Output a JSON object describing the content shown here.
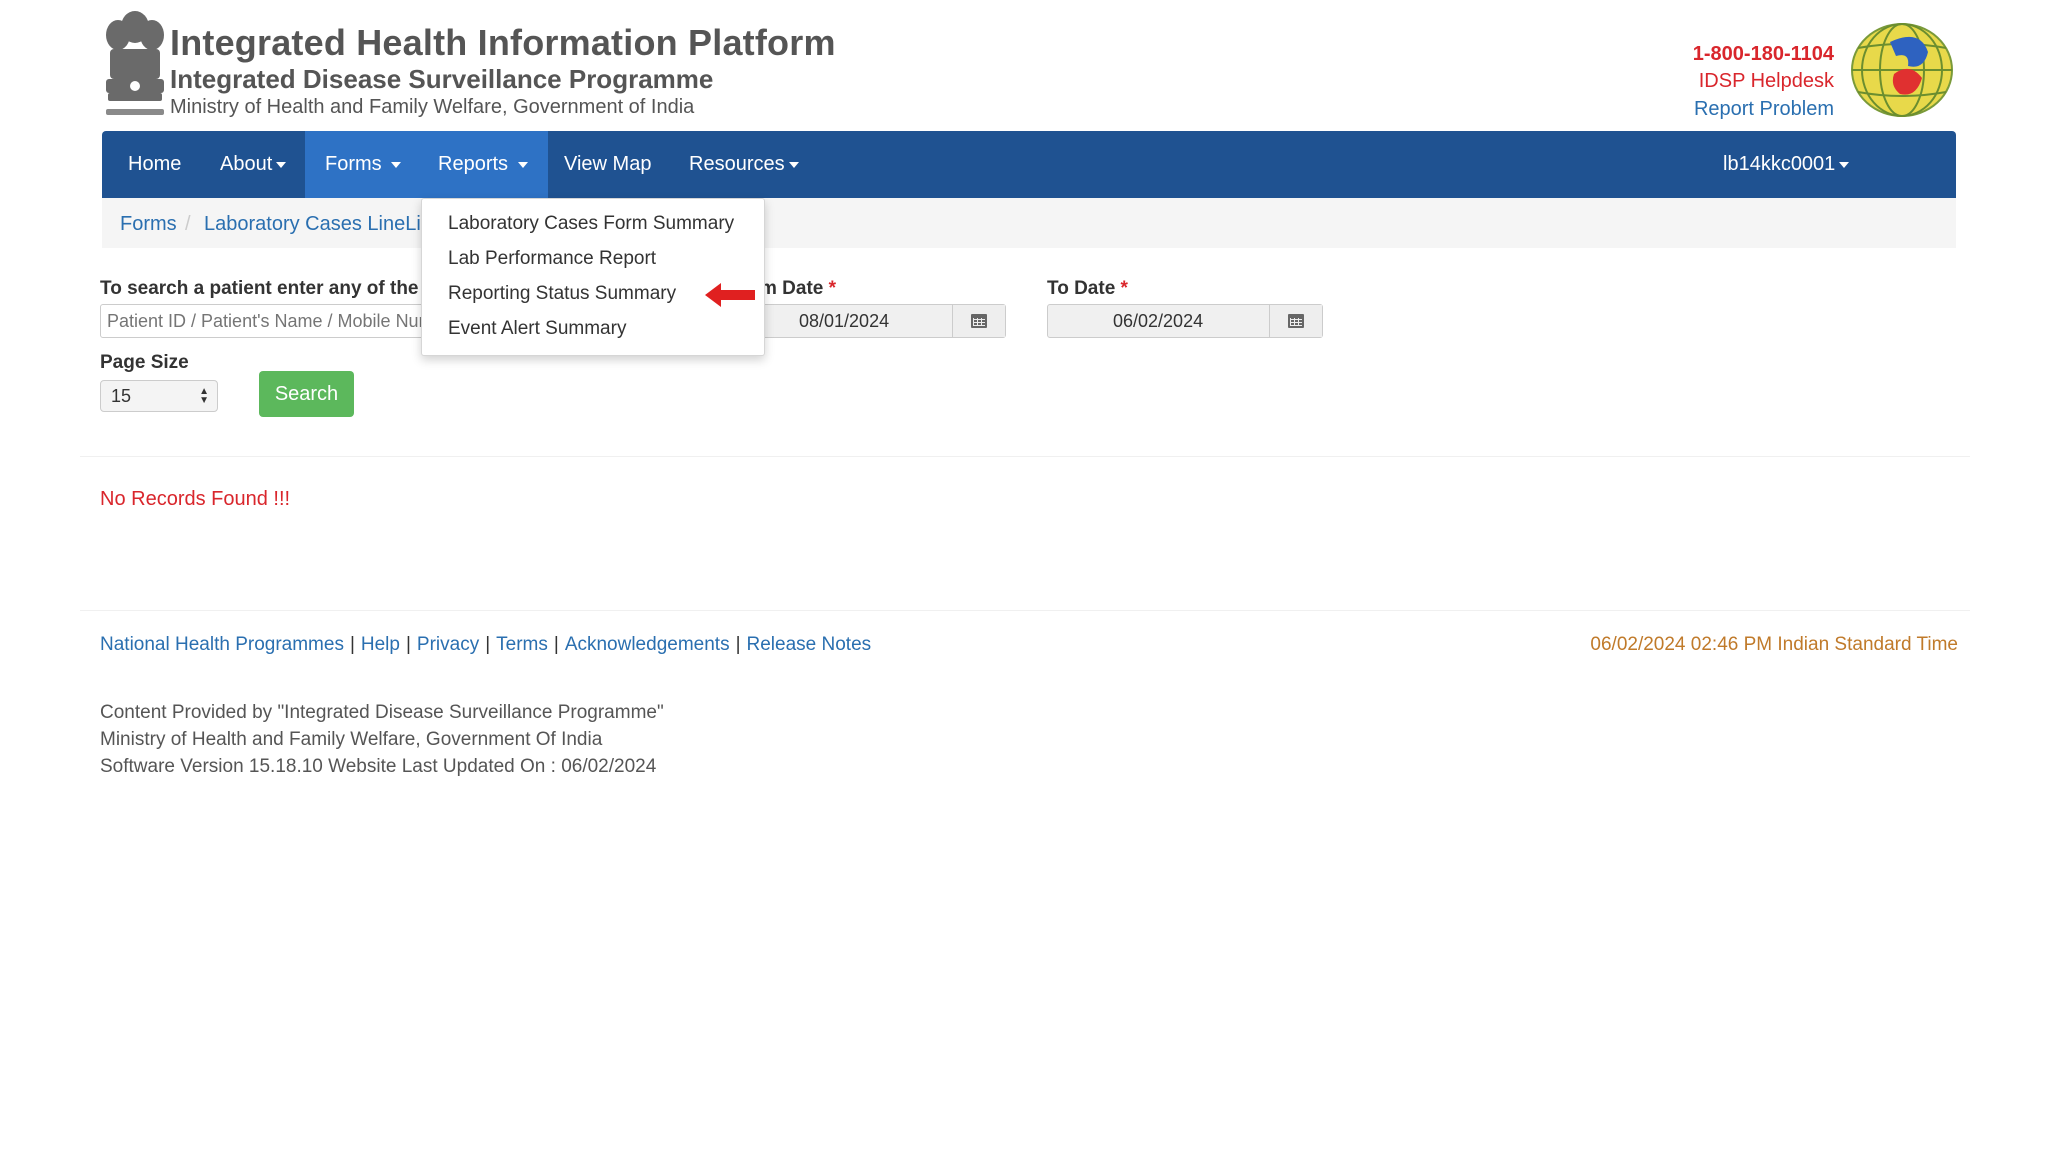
{
  "header": {
    "title": "Integrated Health Information Platform",
    "subtitle": "Integrated Disease Surveillance Programme",
    "ministry": "Ministry of Health and Family Welfare, Government of India",
    "helpline": "1-800-180-1104",
    "helpdesk": "IDSP Helpdesk",
    "report_problem": "Report Problem"
  },
  "nav": {
    "home": "Home",
    "about": "About",
    "forms": "Forms",
    "reports": "Reports",
    "view_map": "View Map",
    "resources": "Resources",
    "user": "lb14kkc0001"
  },
  "breadcrumb": {
    "forms": "Forms",
    "current": "Laboratory Cases LineLis"
  },
  "reports_menu": {
    "items": [
      "Laboratory Cases Form Summary",
      "Lab Performance Report",
      "Reporting Status Summary",
      "Event Alert Summary"
    ]
  },
  "form": {
    "search_label": "To search a patient enter any of the fol",
    "search_placeholder": "Patient ID / Patient's Name / Mobile Nur",
    "from_date_label": "m Date",
    "from_date_value": "08/01/2024",
    "to_date_label": "To Date",
    "to_date_value": "06/02/2024",
    "required_mark": "*",
    "page_size_label": "Page Size",
    "page_size_value": "15",
    "search_button": "Search"
  },
  "results": {
    "message": "No Records Found !!!"
  },
  "footer": {
    "links": [
      "National Health Programmes",
      "Help",
      "Privacy",
      "Terms",
      "Acknowledgements",
      "Release Notes"
    ],
    "timestamp": "06/02/2024 02:46 PM Indian Standard Time",
    "content_provided": "Content Provided by \"Integrated Disease Surveillance Programme\"",
    "ministry": "Ministry of Health and Family Welfare, Government Of India",
    "version": "Software Version 15.18.10  Website Last Updated On :  06/02/2024"
  },
  "colors": {
    "navbar": "#1f5291",
    "navbar_active": "#2e72c5",
    "link": "#2a6fb0",
    "alert_red": "#d9262c",
    "search_button": "#5cb85c",
    "timestamp": "#c07a2a"
  },
  "icons": [
    "national-emblem-icon",
    "idsp-globe-logo-icon",
    "calendar-icon",
    "caret-down-icon",
    "red-arrow-annotation"
  ]
}
